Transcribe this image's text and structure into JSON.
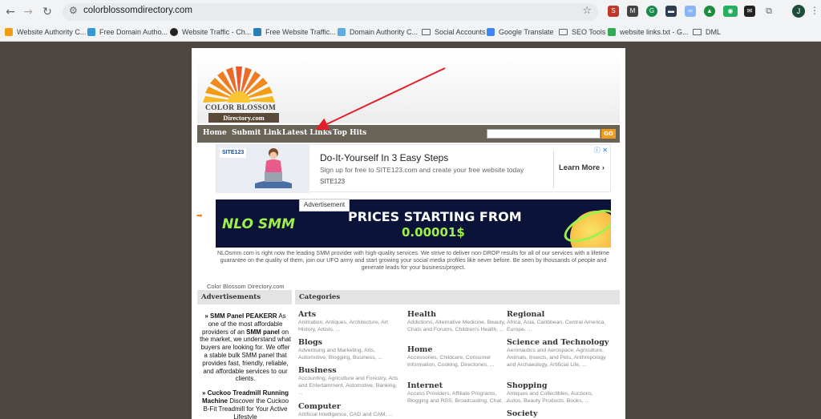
{
  "browser": {
    "url": "colorblossomdirectory.com",
    "profile_initial": "J",
    "bookmarks": [
      {
        "label": "Website Authority C..."
      },
      {
        "label": "Free Domain Autho..."
      },
      {
        "label": "Website Traffic - Ch..."
      },
      {
        "label": "Free Website Traffic..."
      },
      {
        "label": "Domain Authority C..."
      },
      {
        "label": "Social Accounts"
      },
      {
        "label": "Google Translate"
      },
      {
        "label": "SEO Tools"
      },
      {
        "label": "website links.txt - G..."
      },
      {
        "label": "DML"
      }
    ]
  },
  "site": {
    "logo_line1": "COLOR BLOSSOM",
    "logo_line2": "Directory.com",
    "nav": [
      "Home",
      "Submit Link",
      "Latest Links",
      "Top Hits"
    ],
    "search_button": "GO",
    "colors": {
      "nav_bg": "#6a6358",
      "go_btn": "#f29b1d",
      "page_bg": "#4c4740"
    }
  },
  "ad1": {
    "brand": "SITE123",
    "title": "Do-It-Yourself In 3 Easy Steps",
    "subtitle": "Sign up for free to SITE123.com and create your free website today",
    "source": "SITE123",
    "cta": "Learn More"
  },
  "ad2": {
    "label": "Advertisement",
    "logo": "NLO SMM",
    "headline": "PRICES STARTING FROM",
    "price": "0.00001$",
    "description": "NLOsmm.com is right now the leading SMM provider with high-quality services. We strive to deliver non-DROP results for all of our services with a lifetime guarantee on the quality of them, join our UFO army and start growing your social media profiles like never before. Be seen by thousands of people and generate leads for your business/project."
  },
  "directory": {
    "site_label": "Color Blossom Directory.com",
    "ads_heading": "Advertisements",
    "categories_heading": "Categories",
    "sidebar_ads": [
      {
        "prefix": "» SMM Panel PEAKERR",
        "text1": " As one of the most affordable providers of an ",
        "bold": "SMM panel",
        "text2": " on the market, we understand what buyers are looking for. We offer a stable bulk SMM panel that provides fast, friendly, reliable, and affordable services to our clients."
      },
      {
        "prefix": "» Cuckoo Treadmill Running Machine",
        "text1": " Discover the Cuckoo B-Fit Treadmill for Your Active Lifestyle",
        "bold": "",
        "text2": ""
      }
    ],
    "categories": [
      {
        "title": "Arts",
        "subs": "Animation, Antiques, Architecture, Art History, Artists, ..."
      },
      {
        "title": "Blogs",
        "subs": "Advertising and Marketing, Arts, Automotive, Blogging, Business, ..."
      },
      {
        "title": "Business",
        "subs": "Accounting, Agriculture and Forestry, Arts and Entertainment, Automotive, Banking, ..."
      },
      {
        "title": "Computer",
        "subs": "Artificial Intelligence, CAD and CAM, ..."
      },
      {
        "title": "Health",
        "subs": "Addictions, Alternative Medicine, Beauty, Chats and Forums, Children's Health, ..."
      },
      {
        "title": "Home",
        "subs": "Accessories, Childcare, Consumer Information, Cooking, Directories, ..."
      },
      {
        "title": "Internet",
        "subs": "Access Providers, Affiliate Programs, Blogging and RSS, Broadcasting, Chat, ..."
      },
      {
        "title": "Regional",
        "subs": "Africa, Asia, Caribbean, Central America, Europe, ..."
      },
      {
        "title": "Science and Technology",
        "subs": "Aeronautics and Aerospace, Agriculture, Animals, Insects, and Pets, Anthropology and Archaeology, Artificial Life, ..."
      },
      {
        "title": "Shopping",
        "subs": "Antiques and Collectibles, Auctions, Autos, Beauty Products, Books, ..."
      },
      {
        "title": "Society",
        "subs": ""
      }
    ]
  }
}
